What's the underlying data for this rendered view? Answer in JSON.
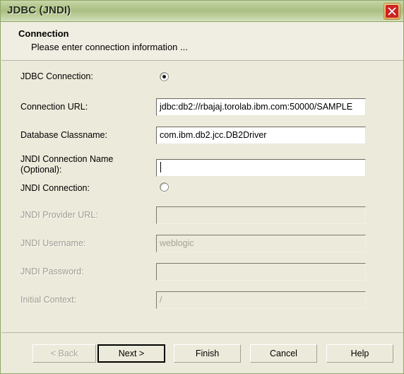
{
  "window": {
    "title": "JDBC (JNDI)",
    "close_icon": "close-icon",
    "close_label": "Close"
  },
  "header": {
    "title": "Connection",
    "subtitle": "Please enter connection information ..."
  },
  "form": {
    "rows": [
      {
        "label": "JDBC Connection:",
        "control": "radio",
        "selected": true,
        "disabled": false
      },
      {
        "label": "Connection URL:",
        "control": "text",
        "value": "jdbc:db2://rbajaj.torolab.ibm.com:50000/SAMPLE",
        "disabled": false
      },
      {
        "label": "Database Classname:",
        "control": "text",
        "value": "com.ibm.db2.jcc.DB2Driver",
        "disabled": false
      },
      {
        "label": "JNDI Connection Name\n(Optional):",
        "control": "text",
        "value": "",
        "focused": true,
        "disabled": false
      },
      {
        "label": "JNDI Connection:",
        "control": "radio",
        "selected": false,
        "disabled": false
      },
      {
        "label": "JNDI Provider URL:",
        "control": "text",
        "value": "",
        "disabled": true
      },
      {
        "label": "JNDI Username:",
        "control": "text",
        "value": "weblogic",
        "disabled": true
      },
      {
        "label": "JNDI Password:",
        "control": "text",
        "value": "",
        "disabled": true
      },
      {
        "label": "Initial Context:",
        "control": "text",
        "value": "/",
        "disabled": true
      }
    ]
  },
  "buttons": {
    "back": "< Back",
    "next": "Next >",
    "finish": "Finish",
    "cancel": "Cancel",
    "help": "Help"
  },
  "colors": {
    "titlebar_green": "#a9bf81",
    "border_green": "#8FA86A",
    "panel_beige": "#ECEADA",
    "header_cream": "#F0EEE2",
    "close_red": "#CC2222",
    "close_orange": "#DCAE5F",
    "disabled_text": "#a5a496"
  }
}
